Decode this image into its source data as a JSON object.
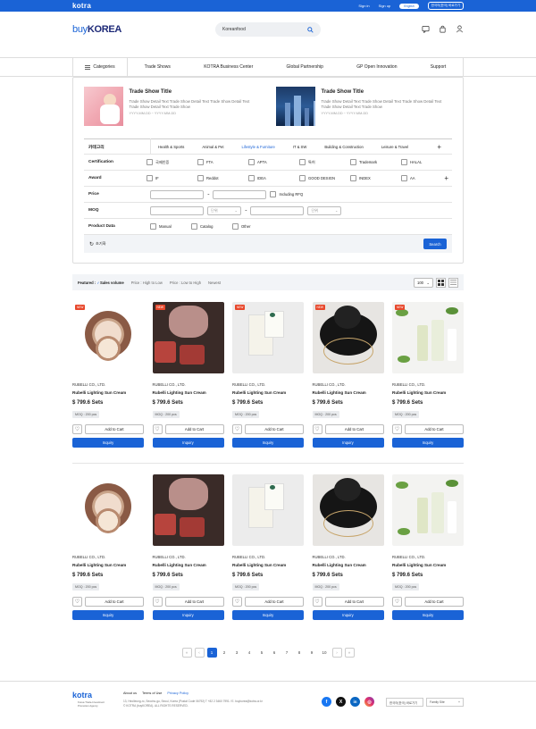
{
  "topbar": {
    "logo": "kotra",
    "sign_in": "Sign in",
    "sign_up": "Sign up",
    "language": "English",
    "center": "한국어(한국) 바로가기"
  },
  "header": {
    "logo_buy": "buy",
    "logo_korea": "KOREA",
    "search_value": "Koreanfood"
  },
  "nav": {
    "categories": "Categories",
    "items": [
      "Trade Shows",
      "KOTRA Business Center",
      "Global Partnership",
      "GP Open Innovation",
      "Support"
    ]
  },
  "shows": [
    {
      "title": "Trade Show Title",
      "desc": "Trade Show Detail Text Trade  Show Detail Text Trade Show Detail Text Trade Show Detail Text Trade  Show",
      "date": "YYYY-MM-DD ~ YYYY-MM-DD"
    },
    {
      "title": "Trade Show Title",
      "desc": "Trade Show Detail Text Trade  Show Detail Text Trade Show Detail Text Trade Show Detail Text Trade  Show",
      "date": "YYYY-MM-DD ~ YYYY-MM-DD"
    }
  ],
  "filters": {
    "category_label": "카테고리",
    "category_tabs": [
      "Health & Sports",
      "Animal & Pet",
      "Lifestyle & Furniture",
      "IT & SW",
      "Building & Construction",
      "Leisure & Travel"
    ],
    "certification_label": "Certification",
    "certifications": [
      "국제인증",
      "FTA",
      "APTA",
      "특허",
      "Trademark",
      "HALAL"
    ],
    "award_label": "Award",
    "awards": [
      "IF",
      "Reddot",
      "IDEA",
      "GOOD DESIGN",
      "INDEX",
      "AA"
    ],
    "price_label": "Price",
    "including_rfq": "Including RFQ",
    "moq_label": "MOQ",
    "unit_placeholder": "단위",
    "product_data_label": "Product Data",
    "product_data": [
      "Manual",
      "Catalog",
      "Other"
    ],
    "reset": "초기화",
    "search": "Search"
  },
  "sortbar": {
    "featured": "Featured :",
    "sales": "Sales volume",
    "price_high": "Price : High to Low",
    "price_low": "Price : Low to High",
    "newest": "Newest",
    "per_page": "100"
  },
  "product": {
    "badge": "NEW",
    "company": "RUBELLI CO., LTD.",
    "name": "Rubelli Lighting Sun Cream",
    "price": "$ 799.6 Sets",
    "moq": "MOQ : 200 pcs",
    "add_to_cart": "Add to Cart",
    "inquiry": "Inquiry"
  },
  "pagination": {
    "pages": [
      "1",
      "2",
      "3",
      "4",
      "5",
      "6",
      "7",
      "8",
      "9",
      "10"
    ],
    "current": "1"
  },
  "footer": {
    "logo": "kotra",
    "sub": "Korea Trade-Investment Promotion Agency",
    "about": "About us",
    "terms": "Terms of Use",
    "privacy": "Privacy Policy",
    "address": "13, Heolleung-ro, Seocho-gu, Seoul, Korea (Postal Code 06792) T +82 2 3460 7991 / E. buykorea@kotra.or.kr",
    "copyright": "© KOTRA (buyKOREA). ALL RIGHTS RESERVED.",
    "center_link": "한국어(한국) 바로가기",
    "family_site": "Family Site"
  },
  "colors": {
    "accent": "#1a63d6",
    "badge": "#e8472b"
  }
}
